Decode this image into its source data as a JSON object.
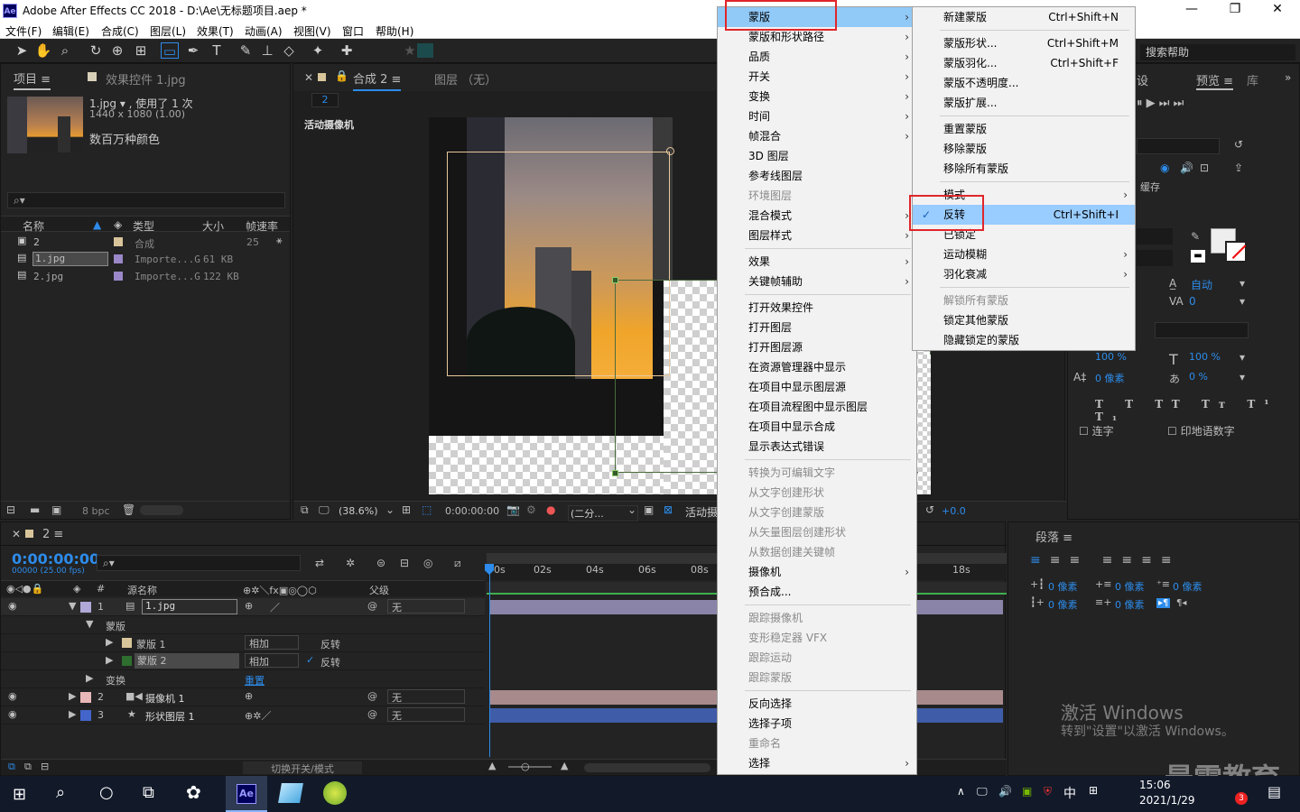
{
  "app": {
    "icon_text": "Ae",
    "title": "Adobe After Effects CC 2018 - D:\\Ae\\无标题项目.aep *",
    "window_buttons": [
      "—",
      "❐",
      "✕"
    ]
  },
  "menubar": [
    "文件(F)",
    "编辑(E)",
    "合成(C)",
    "图层(L)",
    "效果(T)",
    "动画(A)",
    "视图(V)",
    "窗口",
    "帮助(H)"
  ],
  "project_panel": {
    "tab": "项目",
    "effects_tab": "效果控件 1.jpg",
    "file_name": "1.jpg ▾ , 使用了 1 次",
    "file_dims": "1440 x 1080 (1.00)",
    "file_color": "数百万种颜色",
    "search_placeholder": "",
    "columns": [
      "名称",
      "类型",
      "大小",
      "帧速率"
    ],
    "rows": [
      {
        "name": "2",
        "type": "合成",
        "size": "",
        "fps": "25"
      },
      {
        "name": "1.jpg",
        "type": "Importe...G",
        "size": "61 KB",
        "fps": ""
      },
      {
        "name": "2.jpg",
        "type": "Importe...G",
        "size": "122 KB",
        "fps": ""
      }
    ],
    "bpc": "8 bpc"
  },
  "comp_panel": {
    "tab": "合成 2",
    "layer_tab": "图层 （无）",
    "breadcrumb": "2",
    "camera_label": "活动摄像机",
    "zoom": "(38.6%)",
    "timecode": "0:00:00:00",
    "resolution": "(二分...",
    "view_label": "活动摄",
    "exposure": "+0.0"
  },
  "layer_menu": {
    "items": [
      {
        "label": "蒙版",
        "sub": true,
        "highlight": true
      },
      {
        "label": "蒙版和形状路径",
        "sub": true
      },
      {
        "label": "品质",
        "sub": true
      },
      {
        "label": "开关",
        "sub": true
      },
      {
        "label": "变换",
        "sub": true
      },
      {
        "label": "时间",
        "sub": true
      },
      {
        "label": "帧混合",
        "sub": true
      },
      {
        "label": "3D 图层"
      },
      {
        "label": "参考线图层"
      },
      {
        "label": "环境图层",
        "disabled": true
      },
      {
        "label": "混合模式",
        "sub": true
      },
      {
        "label": "图层样式",
        "sub": true
      },
      {
        "sep": true
      },
      {
        "label": "效果",
        "sub": true
      },
      {
        "label": "关键帧辅助",
        "sub": true
      },
      {
        "sep": true
      },
      {
        "label": "打开效果控件"
      },
      {
        "label": "打开图层"
      },
      {
        "label": "打开图层源"
      },
      {
        "label": "在资源管理器中显示"
      },
      {
        "label": "在项目中显示图层源"
      },
      {
        "label": "在项目流程图中显示图层"
      },
      {
        "label": "在项目中显示合成"
      },
      {
        "label": "显示表达式错误"
      },
      {
        "sep": true
      },
      {
        "label": "转换为可编辑文字",
        "disabled": true
      },
      {
        "label": "从文字创建形状",
        "disabled": true
      },
      {
        "label": "从文字创建蒙版",
        "disabled": true
      },
      {
        "label": "从矢量图层创建形状",
        "disabled": true
      },
      {
        "label": "从数据创建关键帧",
        "disabled": true
      },
      {
        "label": "摄像机",
        "sub": true
      },
      {
        "label": "预合成..."
      },
      {
        "sep": true
      },
      {
        "label": "跟踪摄像机",
        "disabled": true
      },
      {
        "label": "变形稳定器 VFX",
        "disabled": true
      },
      {
        "label": "跟踪运动",
        "disabled": true
      },
      {
        "label": "跟踪蒙版",
        "disabled": true
      },
      {
        "sep": true
      },
      {
        "label": "反向选择"
      },
      {
        "label": "选择子项"
      },
      {
        "label": "重命名",
        "disabled": true
      },
      {
        "label": "选择",
        "sub": true
      }
    ]
  },
  "mask_submenu": {
    "items": [
      {
        "label": "新建蒙版",
        "shortcut": "Ctrl+Shift+N"
      },
      {
        "sep": true
      },
      {
        "label": "蒙版形状...",
        "shortcut": "Ctrl+Shift+M"
      },
      {
        "label": "蒙版羽化...",
        "shortcut": "Ctrl+Shift+F"
      },
      {
        "label": "蒙版不透明度..."
      },
      {
        "label": "蒙版扩展..."
      },
      {
        "sep": true
      },
      {
        "label": "重置蒙版"
      },
      {
        "label": "移除蒙版"
      },
      {
        "label": "移除所有蒙版"
      },
      {
        "sep": true
      },
      {
        "label": "模式",
        "sub": true
      },
      {
        "label": "反转",
        "shortcut": "Ctrl+Shift+I",
        "checked": true,
        "highlight": true
      },
      {
        "label": "已锁定"
      },
      {
        "label": "运动模糊",
        "sub": true
      },
      {
        "label": "羽化衰减",
        "sub": true
      },
      {
        "sep": true
      },
      {
        "label": "解锁所有蒙版",
        "disabled": true
      },
      {
        "label": "锁定其他蒙版"
      },
      {
        "label": "隐藏锁定的蒙版"
      }
    ]
  },
  "right_panel": {
    "search_help": "搜索帮助",
    "tab_partial": "设",
    "preview_tab": "预览",
    "lib_tab": "库",
    "cache": "缓存",
    "auto": "自动",
    "zero": "0",
    "font_size": "100 %",
    "scale_h": "100 %",
    "tsume": "0 像素",
    "pct0": "0 %",
    "ligature": "连字",
    "hindi": "印地语数字"
  },
  "paragraph_panel": {
    "tab": "段落",
    "indent_left": "0 像素",
    "indent_right": "0 像素",
    "indent_first": "0 像素",
    "space_before": "0 像素",
    "space_after": "0 像素"
  },
  "timeline": {
    "comp_tab": "2",
    "timecode": "0:00:00:00",
    "frames": "00000 (25.00 fps)",
    "col_num": "#",
    "col_source": "源名称",
    "col_parent": "父级",
    "ruler": [
      "0s",
      "02s",
      "04s",
      "06s",
      "08s",
      "18s"
    ],
    "layers": [
      {
        "num": "1",
        "name": "1.jpg",
        "parent": "无",
        "color": "#b0a8d6"
      },
      {
        "label": "蒙版"
      },
      {
        "label": "蒙版 1",
        "mode": "相加",
        "invert": "反转",
        "checked": false
      },
      {
        "label": "蒙版 2",
        "mode": "相加",
        "invert": "反转",
        "checked": true
      },
      {
        "label": "变换",
        "reset": "重置"
      },
      {
        "num": "2",
        "name": "摄像机 1",
        "parent": "无",
        "color": "#e8b8b8"
      },
      {
        "num": "3",
        "name": "形状图层 1",
        "parent": "无",
        "color": "#4466cc"
      }
    ],
    "footer": "切换开关/模式"
  },
  "watermark": {
    "line1": "激活 Windows",
    "line2": "转到\"设置\"以激活 Windows。",
    "brand": "最需教育"
  },
  "taskbar": {
    "time": "15:06",
    "date": "2021/1/29",
    "ime": "中",
    "badge": "3"
  }
}
